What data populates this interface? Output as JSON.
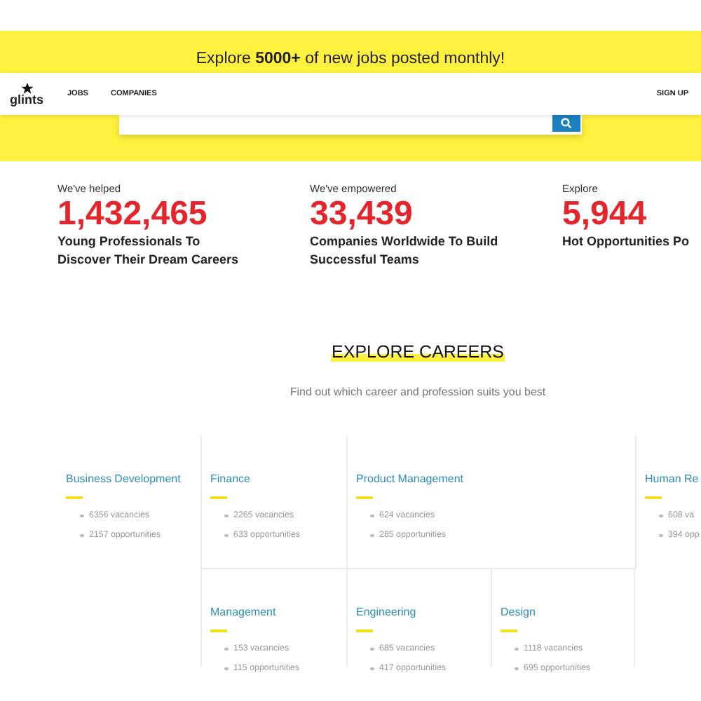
{
  "banner": {
    "headline": "Explore **5000+** of new jobs posted monthly!"
  },
  "navbar": {
    "logo": "glints",
    "links": [
      "JOBS",
      "COMPANIES"
    ],
    "sign_up": "SIGN UP"
  },
  "stats": [
    {
      "label": "We've helped",
      "number": "1,432,465",
      "description": "Young Professionals To Discover Their Dream Careers"
    },
    {
      "label": "We've empowered",
      "number": "33,439",
      "description": "Companies Worldwide To Build Successful Teams"
    },
    {
      "label": "Explore",
      "number": "5,944",
      "description": "Hot Opportunities Po"
    }
  ],
  "careers": {
    "title": "EXPLORE CAREERS",
    "subtitle": "Find out which career and profession suits you best",
    "rows": [
      [
        {
          "name": "Business Development",
          "vacancies": "6356 vacancies",
          "opportunities": "2157 opportunities"
        },
        {
          "name": "Finance",
          "vacancies": "2265 vacancies",
          "opportunities": "633 opportunities"
        },
        {
          "name": "Product Management",
          "vacancies": "624 vacancies",
          "opportunities": "285 opportunities"
        },
        {
          "name": "Human Re",
          "vacancies": "608 va",
          "opportunities": "394 opp"
        }
      ],
      [
        "",
        {
          "name": "Management",
          "vacancies": "153 vacancies",
          "opportunities": "115 opportunities"
        },
        {
          "name": "Engineering",
          "vacancies": "685 vacancies",
          "opportunities": "417 opportunities"
        },
        {
          "name": "Design",
          "vacancies": "1118 vacancies",
          "opportunities": "695 opportunities"
        }
      ]
    ]
  }
}
